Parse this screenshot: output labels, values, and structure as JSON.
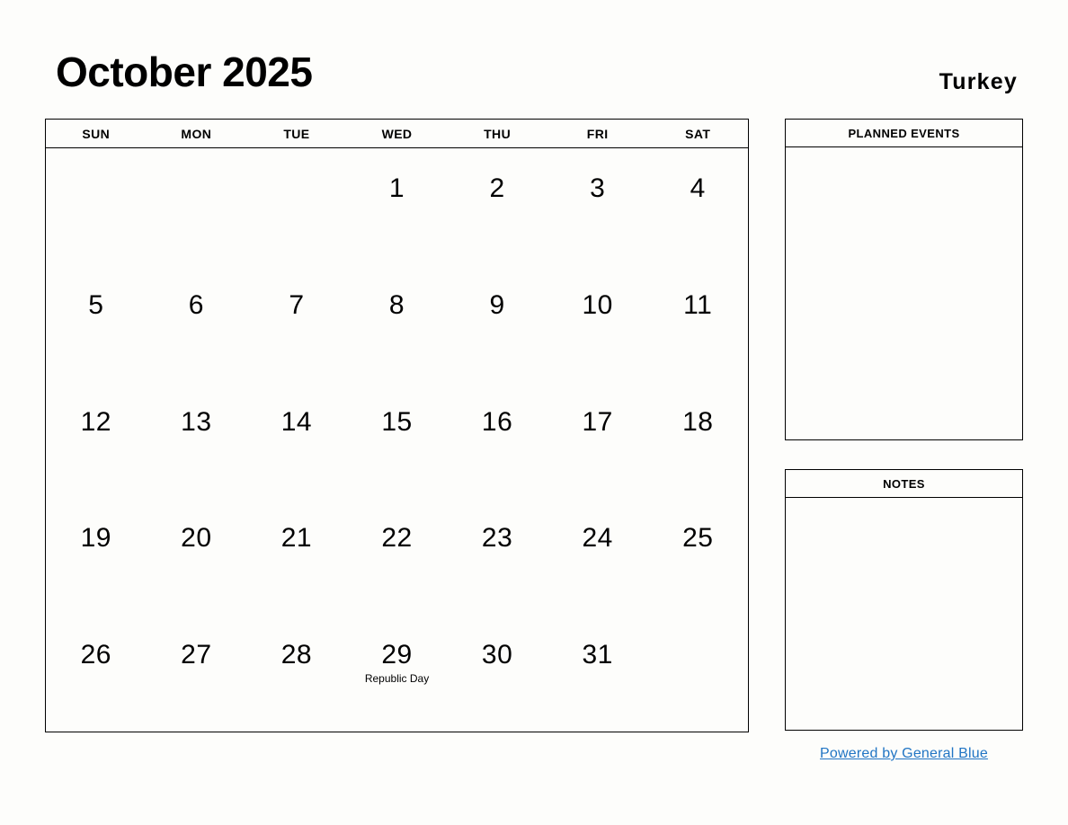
{
  "header": {
    "title": "October 2025",
    "country": "Turkey"
  },
  "calendar": {
    "weekdays": [
      "SUN",
      "MON",
      "TUE",
      "WED",
      "THU",
      "FRI",
      "SAT"
    ],
    "weeks": [
      [
        {
          "day": ""
        },
        {
          "day": ""
        },
        {
          "day": ""
        },
        {
          "day": "1"
        },
        {
          "day": "2"
        },
        {
          "day": "3"
        },
        {
          "day": "4"
        }
      ],
      [
        {
          "day": "5"
        },
        {
          "day": "6"
        },
        {
          "day": "7"
        },
        {
          "day": "8"
        },
        {
          "day": "9"
        },
        {
          "day": "10"
        },
        {
          "day": "11"
        }
      ],
      [
        {
          "day": "12"
        },
        {
          "day": "13"
        },
        {
          "day": "14"
        },
        {
          "day": "15"
        },
        {
          "day": "16"
        },
        {
          "day": "17"
        },
        {
          "day": "18"
        }
      ],
      [
        {
          "day": "19"
        },
        {
          "day": "20"
        },
        {
          "day": "21"
        },
        {
          "day": "22"
        },
        {
          "day": "23"
        },
        {
          "day": "24"
        },
        {
          "day": "25"
        }
      ],
      [
        {
          "day": "26"
        },
        {
          "day": "27"
        },
        {
          "day": "28"
        },
        {
          "day": "29",
          "event": "Republic Day"
        },
        {
          "day": "30"
        },
        {
          "day": "31"
        },
        {
          "day": ""
        }
      ]
    ]
  },
  "panels": {
    "events_title": "PLANNED EVENTS",
    "notes_title": "NOTES"
  },
  "footer": {
    "link_text": "Powered by General Blue",
    "link_color": "#2175c4"
  }
}
